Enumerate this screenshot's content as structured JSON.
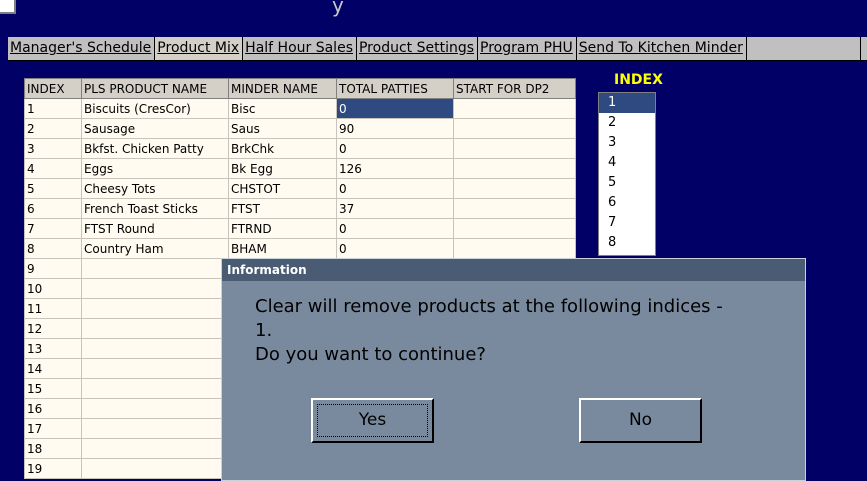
{
  "tabs": [
    {
      "label": "Manager's Schedule"
    },
    {
      "label": "Product Mix"
    },
    {
      "label": "Half Hour Sales"
    },
    {
      "label": "Product Settings"
    },
    {
      "label": "Program PHU"
    },
    {
      "label": "Send To Kitchen Minder"
    }
  ],
  "table": {
    "headers": [
      "INDEX",
      "PLS PRODUCT NAME",
      "MINDER NAME",
      "TOTAL PATTIES",
      "START FOR DP2"
    ],
    "rows": [
      [
        "1",
        "Biscuits (CresCor)",
        "Bisc",
        "0",
        ""
      ],
      [
        "2",
        "Sausage",
        "Saus",
        "90",
        ""
      ],
      [
        "3",
        "Bkfst. Chicken Patty",
        "BrkChk",
        "0",
        ""
      ],
      [
        "4",
        "Eggs",
        "Bk Egg",
        "126",
        ""
      ],
      [
        "5",
        "Cheesy Tots",
        "CHSTOT",
        "0",
        ""
      ],
      [
        "6",
        "French Toast Sticks",
        "FTST",
        "37",
        ""
      ],
      [
        "7",
        "FTST Round",
        "FTRND",
        "0",
        ""
      ],
      [
        "8",
        "Country Ham",
        "BHAM",
        "0",
        ""
      ],
      [
        "9",
        "",
        "",
        "",
        ""
      ],
      [
        "10",
        "",
        "",
        "",
        ""
      ],
      [
        "11",
        "",
        "",
        "",
        ""
      ],
      [
        "12",
        "",
        "",
        "",
        ""
      ],
      [
        "13",
        "",
        "",
        "",
        ""
      ],
      [
        "14",
        "",
        "",
        "",
        ""
      ],
      [
        "15",
        "",
        "",
        "",
        ""
      ],
      [
        "16",
        "",
        "",
        "",
        ""
      ],
      [
        "17",
        "",
        "",
        "",
        ""
      ],
      [
        "18",
        "",
        "",
        "",
        ""
      ],
      [
        "19",
        "",
        "",
        "",
        ""
      ]
    ]
  },
  "index_panel": {
    "title": "INDEX",
    "items": [
      "1",
      "2",
      "3",
      "4",
      "5",
      "6",
      "7",
      "8"
    ]
  },
  "dialog": {
    "title": "Information",
    "message_line1": "Clear will remove products at the following indices -",
    "message_line2": "1.",
    "message_line3": "Do you want to continue?",
    "yes_label": "Yes",
    "no_label": "No"
  },
  "colors": {
    "background": "#000066",
    "selection": "#2e4a80",
    "index_title": "#ffff00",
    "dialog_body": "#7a8a9e",
    "dialog_titlebar": "#4a5c74"
  }
}
